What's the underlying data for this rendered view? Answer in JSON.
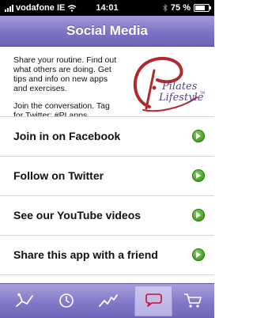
{
  "status_bar": {
    "carrier": "vodafone IE",
    "time": "14:01",
    "battery_percent": "75 %",
    "battery_level": 0.75
  },
  "nav": {
    "title": "Social Media"
  },
  "intro": {
    "para1": "Share your routine. Find out what others are doing. Get tips and info on new apps and exercises.",
    "para2": "Join the conversation. Tag for Twitter: #PLapps",
    "logo_word1": "Pilates",
    "logo_word2": "Lifestyle",
    "logo_tm": "TM"
  },
  "rows": [
    {
      "label": "Join in on Facebook"
    },
    {
      "label": "Follow on Twitter"
    },
    {
      "label": "See our YouTube videos"
    },
    {
      "label": "Share this app with a friend"
    }
  ],
  "tabs": [
    {
      "icon": "pose-icon",
      "active": false
    },
    {
      "icon": "clock-icon",
      "active": false
    },
    {
      "icon": "chart-line-icon",
      "active": false
    },
    {
      "icon": "speech-bubble-icon",
      "active": true
    },
    {
      "icon": "cart-icon",
      "active": false
    }
  ],
  "colors": {
    "nav_gradient_top": "#a39bd8",
    "nav_gradient_bottom": "#6d63b8",
    "go_green": "#3f9a21",
    "logo_red": "#b3282d",
    "logo_purple": "#5a3f8a"
  }
}
